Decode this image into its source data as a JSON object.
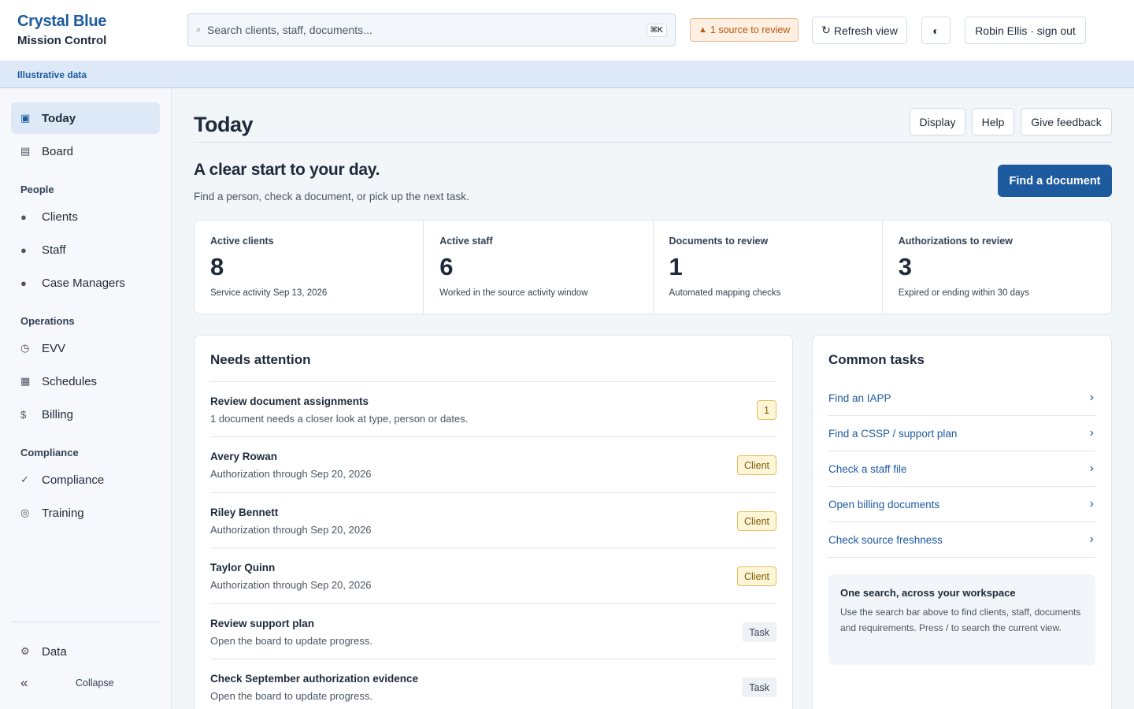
{
  "brand": {
    "name": "Crystal Blue",
    "subtitle": "Mission Control"
  },
  "topbar": {
    "search_placeholder": "Search clients, staff, documents...",
    "search_shortcut": "⌘K",
    "review_badge": "1 source to review",
    "refresh_label": "Refresh view",
    "user_label": "Robin Ellis · sign out"
  },
  "banner": {
    "text": "Illustrative data"
  },
  "sidebar": {
    "items": [
      {
        "label": "Today",
        "icon": "square-icon"
      },
      {
        "label": "Board",
        "icon": "board-icon"
      },
      {
        "label": "Clients",
        "icon": "dot-icon"
      },
      {
        "label": "Staff",
        "icon": "dot-icon"
      },
      {
        "label": "Case Managers",
        "icon": "dot-icon"
      },
      {
        "label": "EVV",
        "icon": "clock-icon"
      },
      {
        "label": "Schedules",
        "icon": "grid-icon"
      },
      {
        "label": "Billing",
        "icon": "dollar-icon"
      },
      {
        "label": "Compliance",
        "icon": "check-icon"
      },
      {
        "label": "Training",
        "icon": "target-icon"
      },
      {
        "label": "Data",
        "icon": "gear-icon"
      }
    ],
    "sections": [
      "People",
      "Operations",
      "Compliance"
    ],
    "collapse_label": "Collapse"
  },
  "header": {
    "title": "Today",
    "display_label": "Display",
    "help_label": "Help",
    "feedback_label": "Give feedback"
  },
  "hero": {
    "title": "A clear start to your day.",
    "subtitle": "Find a person, check a document, or pick up the next task.",
    "cta": "Find a document"
  },
  "stats": [
    {
      "label": "Active clients",
      "value": "8",
      "note": "Service activity Sep 13, 2026"
    },
    {
      "label": "Active staff",
      "value": "6",
      "note": "Worked in the source activity window"
    },
    {
      "label": "Documents to review",
      "value": "1",
      "note": "Automated mapping checks"
    },
    {
      "label": "Authorizations to review",
      "value": "3",
      "note": "Expired or ending within 30 days"
    }
  ],
  "attention": {
    "title": "Needs attention",
    "rows": [
      {
        "title": "Review document assignments",
        "subtitle": "1 document needs a closer look at type, person or dates.",
        "tag": "1"
      },
      {
        "title": "Avery Rowan",
        "subtitle": "Authorization through Sep 20, 2026",
        "tag": "Client"
      },
      {
        "title": "Riley Bennett",
        "subtitle": "Authorization through Sep 20, 2026",
        "tag": "Client"
      },
      {
        "title": "Taylor Quinn",
        "subtitle": "Authorization through Sep 20, 2026",
        "tag": "Client"
      },
      {
        "title": "Review support plan",
        "subtitle": "Open the board to update progress.",
        "tag": "Task"
      },
      {
        "title": "Check September authorization evidence",
        "subtitle": "Open the board to update progress.",
        "tag": "Task"
      }
    ]
  },
  "tasks": {
    "title": "Common tasks",
    "links": [
      "Find an IAPP",
      "Find a CSSP / support plan",
      "Check a staff file",
      "Open billing documents",
      "Check source freshness"
    ],
    "tip_title": "One search, across your workspace",
    "tip_body": "Use the search bar above to find clients, staff, documents and requirements. Press / to search the current view."
  }
}
